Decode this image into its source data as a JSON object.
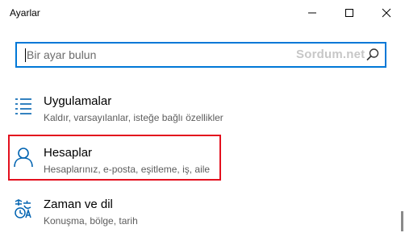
{
  "window": {
    "title": "Ayarlar",
    "controls": {
      "minimize": "minimize-icon",
      "maximize": "maximize-icon",
      "close": "close-icon"
    }
  },
  "search": {
    "placeholder": "Bir ayar bulun",
    "watermark": "Sordum.net",
    "icon": "search-icon",
    "accent_color": "#0078d7"
  },
  "categories": [
    {
      "icon": "apps-list-icon",
      "label": "Uygulamalar",
      "description": "Kaldır, varsayılanlar, isteğe bağlı özellikler"
    },
    {
      "icon": "person-icon",
      "label": "Hesaplar",
      "description": "Hesaplarınız, e-posta, eşitleme, iş, aile",
      "highlighted": true
    },
    {
      "icon": "time-language-icon",
      "label": "Zaman ve dil",
      "description": "Konuşma, bölge, tarih"
    }
  ],
  "colors": {
    "icon_blue": "#0063b1",
    "highlight_red": "#e3101e"
  }
}
